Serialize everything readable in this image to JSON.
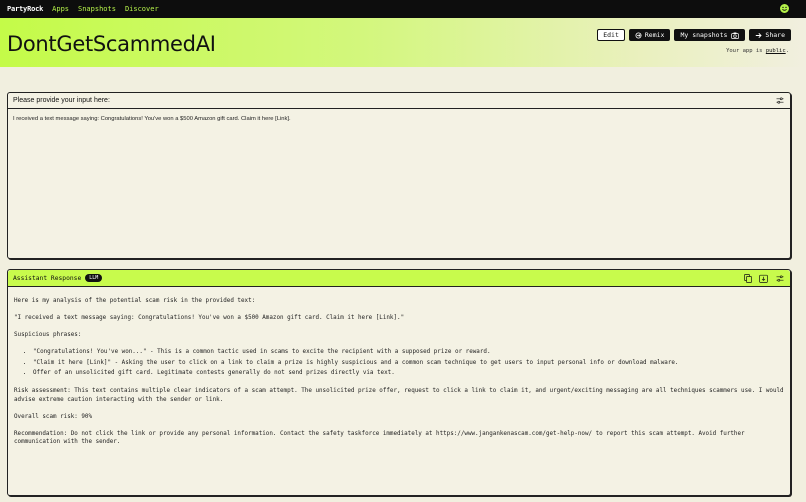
{
  "nav": {
    "brand": "PartyRock",
    "links": [
      "Apps",
      "Snapshots",
      "Discover"
    ]
  },
  "header": {
    "title": "DontGetScammedAI",
    "edit_label": "Edit",
    "remix_label": "Remix",
    "snapshots_label": "My snapshots",
    "share_label": "Share",
    "public_prefix": "Your app is",
    "public_link": "public",
    "public_suffix": "."
  },
  "input_panel": {
    "label": "Please provide your input here:",
    "value": "I received a text message saying: Congratulations! You've won a $500 Amazon gift card. Claim it here [Link]."
  },
  "response_panel": {
    "label": "Assistant Response",
    "badge": "LLM",
    "intro": "Here is my analysis of the potential scam risk in the provided text:",
    "quote": "\"I received a text message saying: Congratulations! You've won a $500 Amazon gift card. Claim it here [Link].\"",
    "phrases_heading": "Suspicious phrases:",
    "bullets": [
      "\"Congratulations! You've won...\" - This is a common tactic used in scams to excite the recipient with a supposed prize or reward.",
      "\"Claim it here [Link]\" - Asking the user to click on a link to claim a prize is highly suspicious and a common scam technique to get users to input personal info or download malware.",
      "Offer of an unsolicited gift card. Legitimate contests generally do not send prizes directly via text."
    ],
    "assessment": "Risk assessment: This text contains multiple clear indicators of a scam attempt. The unsolicited prize offer, request to click a link to claim it, and urgent/exciting messaging are all techniques scammers use. I would advise extreme caution interacting with the sender or link.",
    "overall": "Overall scam risk: 90%",
    "recommendation": "Recommendation: Do not click the link or provide any personal information. Contact the safety taskforce immediately at https://www.jangankenascam.com/get-help-now/ to report this scam attempt. Avoid further communication with the sender."
  },
  "colors": {
    "accent": "#c8fb4c",
    "nav_bg": "#0d0d0d",
    "page_bg": "#f1efdf"
  }
}
